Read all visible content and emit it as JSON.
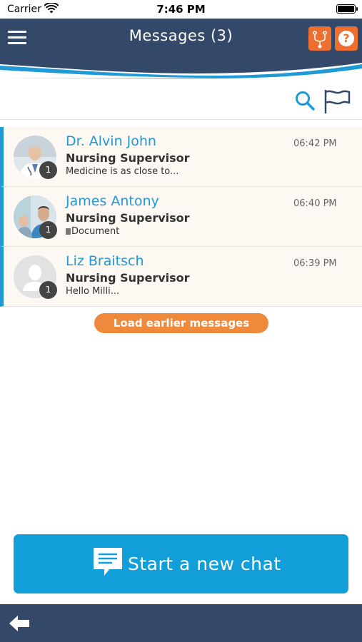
{
  "status_bar": {
    "carrier": "Carrier",
    "time": "7:46 PM"
  },
  "header": {
    "title": "Messages (3)",
    "menu_icon": "hamburger-menu-icon",
    "stethoscope_icon": "stethoscope-icon",
    "help_icon": "question-mark-icon",
    "help_glyph": "?"
  },
  "toolbar": {
    "search_icon": "search-icon",
    "flag_icon": "flag-icon"
  },
  "messages": [
    {
      "name": "Dr. Alvin John",
      "role": "Nursing Supervisor",
      "preview": "Medicine is as close to...",
      "time": "06:42 PM",
      "unread": "1"
    },
    {
      "name": "James Antony",
      "role": "Nursing Supervisor",
      "preview": "Document",
      "time": "06:40 PM",
      "unread": "1"
    },
    {
      "name": "Liz Braitsch",
      "role": "Nursing Supervisor",
      "preview": "Hello Milli...",
      "time": "06:39 PM",
      "unread": "1"
    }
  ],
  "load_earlier": "Load earlier messages",
  "new_chat": {
    "label": "Start a new chat",
    "icon": "chat-bubble-icon"
  },
  "bottom_bar": {
    "back_icon": "back-arrow-icon"
  },
  "colors": {
    "header": "#34496a",
    "accent_blue": "#1f9ad6",
    "orange": "#ef6f30",
    "button_blue": "#129fd9",
    "row_bg": "#fdf8f2"
  }
}
